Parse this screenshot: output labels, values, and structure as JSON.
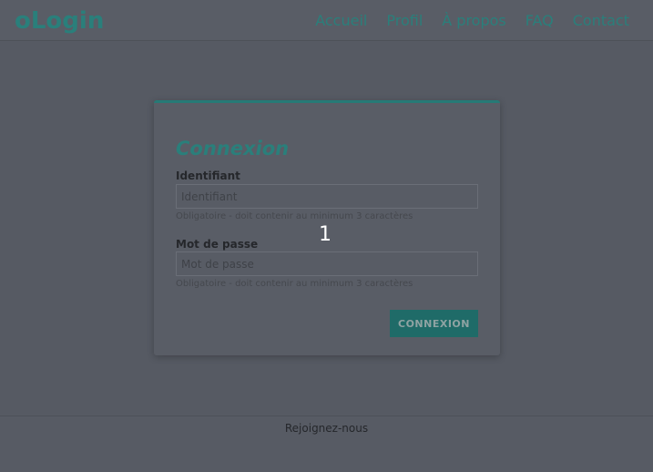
{
  "header": {
    "brand": "oLogin",
    "nav": [
      "Accueil",
      "Profil",
      "À propos",
      "FAQ",
      "Contact"
    ]
  },
  "login": {
    "title": "Connexion",
    "username_label": "Identifiant",
    "username_placeholder": "Identifiant",
    "username_hint": "Obligatoire - doit contenir au minimum 3 caractères",
    "password_label": "Mot de passe",
    "password_placeholder": "Mot de passe",
    "password_hint": "Obligatoire - doit contenir au minimum 3 caractères",
    "submit_label": "CONNEXION"
  },
  "overlay": {
    "badge": "1"
  },
  "footer": {
    "link": "Rejoignez-nous"
  },
  "colors": {
    "accent": "#2a7f7b",
    "background": "#565a63"
  }
}
